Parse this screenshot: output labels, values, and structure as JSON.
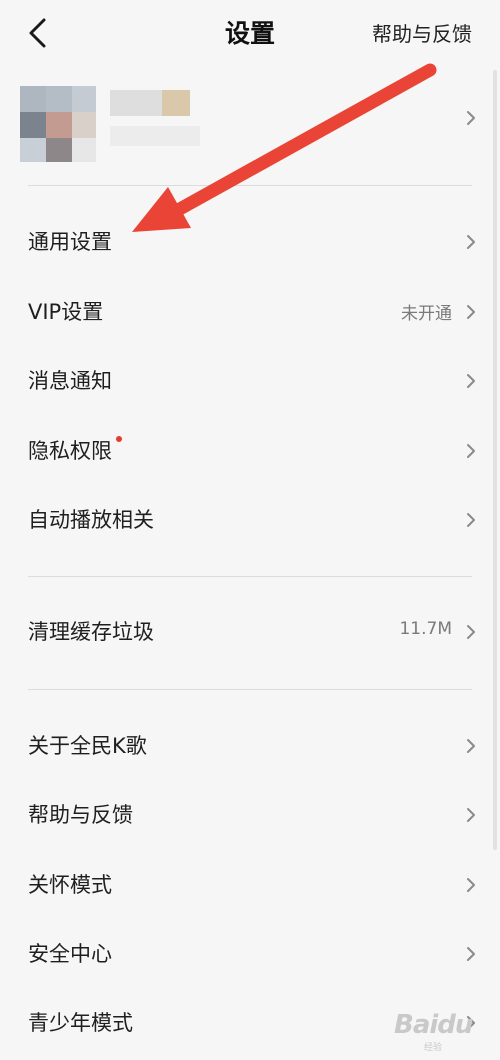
{
  "header": {
    "back_icon": "chevron-left-icon",
    "title": "设置",
    "help_link": "帮助与反馈"
  },
  "profile": {
    "avatar": "blurred-avatar-image",
    "name": "blurred-username",
    "chevron_icon": "chevron-right-icon"
  },
  "group1": [
    {
      "label": "通用设置",
      "value": ""
    },
    {
      "label": "VIP设置",
      "value": "未开通"
    },
    {
      "label": "消息通知",
      "value": ""
    },
    {
      "label": "隐私权限",
      "value": "",
      "badge": "red-dot"
    },
    {
      "label": "自动播放相关",
      "value": ""
    }
  ],
  "group2": [
    {
      "label": "清理缓存垃圾",
      "value": "11.7M"
    }
  ],
  "group3": [
    {
      "label": "关于全民K歌",
      "value": ""
    },
    {
      "label": "帮助与反馈",
      "value": ""
    },
    {
      "label": "关怀模式",
      "value": ""
    },
    {
      "label": "安全中心",
      "value": ""
    },
    {
      "label": "青少年模式",
      "value": ""
    }
  ],
  "annotation": {
    "arrow_color": "#e94435",
    "arrow_icon": "annotation-arrow"
  },
  "watermark": {
    "text": "Baidu",
    "sub": "经验"
  },
  "colors": {
    "background": "#f6f6f6",
    "text": "#1f1f1f",
    "secondary_text": "#7a7a7a",
    "chevron": "#8a8a8a",
    "divider": "#dcdcdc",
    "badge": "#e83a2c"
  }
}
